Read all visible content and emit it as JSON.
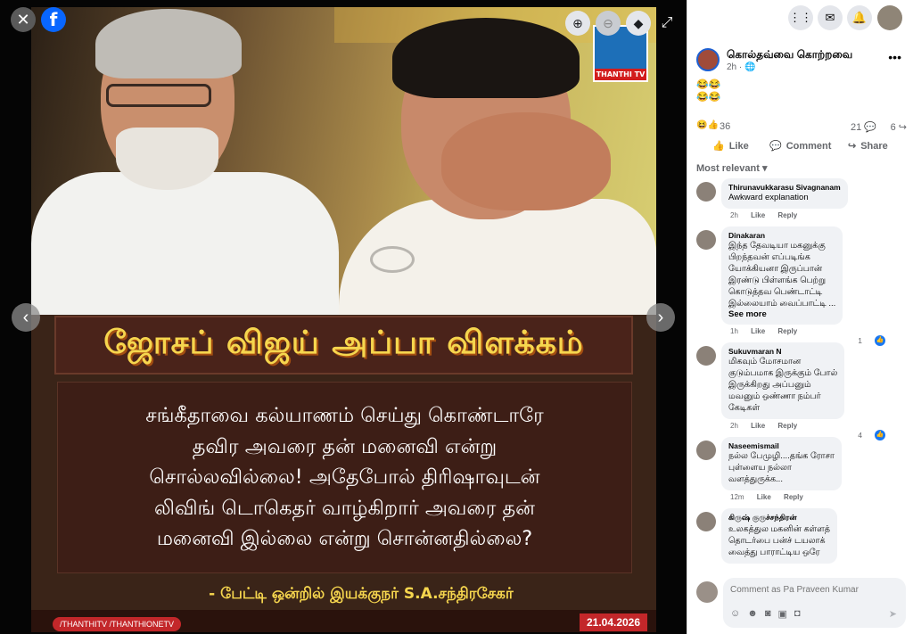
{
  "viewer": {
    "close_icon": "close-icon",
    "logo_letter": "f",
    "zoom_in_icon": "zoom-in-icon",
    "zoom_out_icon": "zoom-out-icon",
    "tag_icon": "tag-icon",
    "fullscreen_icon": "fullscreen-icon",
    "prev_icon": "chevron-left-icon",
    "next_icon": "chevron-right-icon"
  },
  "photo": {
    "channel": "THANTHI TV",
    "title": "ஜோசப் விஜய் அப்பா விளக்கம்",
    "quote": "சங்கீதாவை கல்யாணம் செய்து கொண்டாரே\nதவிர அவரை தன் மனைவி என்று\nசொல்லவில்லை! அதேபோல் திரிஷாவுடன்\nலிவிங் டொகெதர் வாழ்கிறார் அவரை தன்\nமனைவி இல்லை என்று சொன்னதில்லை?",
    "source": "- பேட்டி ஒன்றில் இயக்குநர் S.A.சந்திரசேகர்",
    "handles": "/THANTHITV   /THANTHIONETV",
    "date": "21.04.2026"
  },
  "post": {
    "author": "கொல்தவ்வை கொற்றவை",
    "time": "2h · ",
    "emojis": "😂😂\n😂😂",
    "reactions_count": "36",
    "comments_count": "21",
    "shares_count": "6",
    "like_label": "Like",
    "comment_label": "Comment",
    "share_label": "Share",
    "sort_label": "Most relevant"
  },
  "comments": [
    {
      "name": "Thirunavukkarasu Sivagnanam",
      "text": "Awkward explanation",
      "more": "",
      "time": "2h",
      "like": "Like",
      "reply": "Reply",
      "reactions": ""
    },
    {
      "name": "Dinakaran",
      "text": "இந்த தேவடியா மகனுக்கு\nபிறந்தவன் எப்படிங்க\nயோக்கியனா இருப்பான்\nஇரண்டு பிள்ளங்க பெற்று\nகொடுத்தவ பெண்டாட்டி\nஇல்லையாம் வைப்பாட்டி ...",
      "more": "See more",
      "time": "1h",
      "like": "Like",
      "reply": "Reply",
      "reactions": "1"
    },
    {
      "name": "Sukuvmaran N",
      "text": "மிகவும் மோசமான\nகுடும்பமாக இருக்கும் போல்\nஇருக்கிறது அப்பனும்\nமவனும் ஒண்ணா நம்பர்\nகேடிகள்",
      "more": "",
      "time": "2h",
      "like": "Like",
      "reply": "Reply",
      "reactions": "4"
    },
    {
      "name": "Naseemismail",
      "text": "நல்ல பேமுழி....தங்க ரோசா\nபுள்ளைய நல்லா\nவளத்துருக்க...",
      "more": "",
      "time": "12m",
      "like": "Like",
      "reply": "Reply",
      "reactions": ""
    },
    {
      "name": "கிருஷ் குருச்சந்திரன்",
      "text": "உலகத்துல மகனின் கள்ளத்\nதொடர்பை பன்ச் டயலாக்\nவைத்து பாராட்டிய ஒரே",
      "more": "",
      "time": "",
      "like": "",
      "reply": "",
      "reactions": ""
    }
  ],
  "composer": {
    "placeholder": "Comment as Pa Praveen Kumar"
  }
}
